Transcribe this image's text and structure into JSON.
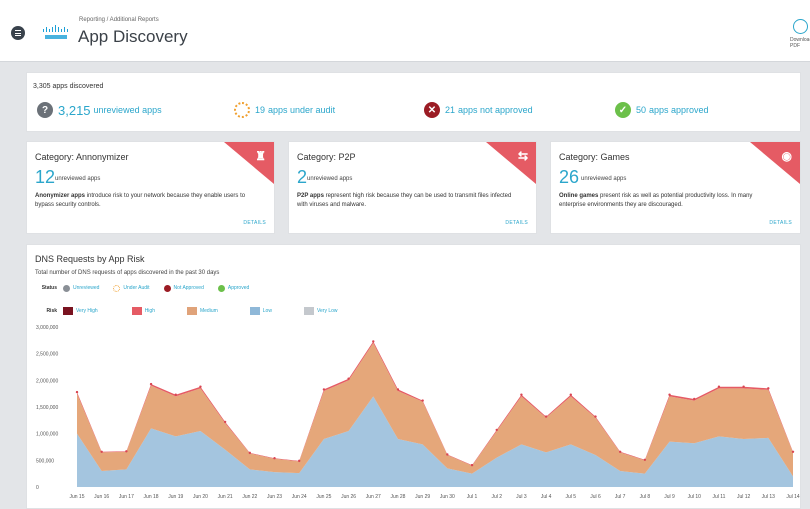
{
  "header": {
    "breadcrumb": "Reporting / Additional Reports",
    "title": "App Discovery",
    "download_label": "Download PDF"
  },
  "summary": {
    "discovered": "3,305 apps discovered",
    "stats": [
      {
        "count": "3,215",
        "label": "unreviewed apps",
        "icon": "question-icon",
        "color": "#6b7178"
      },
      {
        "count": "19",
        "label": "apps under audit",
        "icon": "under-audit-icon",
        "color": "#f0a030"
      },
      {
        "count": "21",
        "label": "apps not approved",
        "icon": "not-approved-icon",
        "color": "#9b1c24"
      },
      {
        "count": "50",
        "label": "apps approved",
        "icon": "approved-icon",
        "color": "#6cc04a"
      }
    ]
  },
  "cards": [
    {
      "title": "Category: Annonymizer",
      "count": "12",
      "count_label": "unreviewed apps",
      "desc_bold": "Anonymizer apps",
      "desc": " introduce risk to your network because they enable users to bypass security controls.",
      "details": "DETAILS",
      "icon": "anonymizer-icon"
    },
    {
      "title": "Category: P2P",
      "count": "2",
      "count_label": "unreviewed apps",
      "desc_bold": "P2P apps",
      "desc": " represent high risk because they can be used to transmit files infected with viruses and malware.",
      "details": "DETAILS",
      "icon": "transfer-icon"
    },
    {
      "title": "Category: Games",
      "count": "26",
      "count_label": "unreviewed apps",
      "desc_bold": "Online games",
      "desc": " present risk as well as potential productivity loss. In many enterprise environments they are discouraged.",
      "details": "DETAILS",
      "icon": "gamepad-icon"
    }
  ],
  "chart_panel": {
    "title": "DNS Requests by App Risk",
    "subtitle": "Total number of DNS requests of apps discovered in the past 30 days",
    "status_label": "Status",
    "status_items": [
      {
        "label": "Unreviewed",
        "color": "#8a8f96"
      },
      {
        "label": "Under Audit",
        "color": "#f0a030"
      },
      {
        "label": "Not Approved",
        "color": "#9b1c24"
      },
      {
        "label": "Approved",
        "color": "#6cc04a"
      }
    ],
    "risk_label": "Risk",
    "risk_items": [
      {
        "label": "Very High",
        "color": "#7a1320"
      },
      {
        "label": "High",
        "color": "#e55b64"
      },
      {
        "label": "Medium",
        "color": "#e0a37a"
      },
      {
        "label": "Low",
        "color": "#8fb8d8"
      },
      {
        "label": "Very Low",
        "color": "#c4c8cd"
      }
    ]
  },
  "chart_data": {
    "type": "area",
    "x": [
      "Jun 15",
      "Jun 16",
      "Jun 17",
      "Jun 18",
      "Jun 19",
      "Jun 20",
      "Jun 21",
      "Jun 22",
      "Jun 23",
      "Jun 24",
      "Jun 25",
      "Jun 26",
      "Jun 27",
      "Jun 28",
      "Jun 29",
      "Jun 30",
      "Jul 1",
      "Jul 2",
      "Jul 3",
      "Jul 4",
      "Jul 5",
      "Jul 6",
      "Jul 7",
      "Jul 8",
      "Jul 9",
      "Jul 10",
      "Jul 11",
      "Jul 12",
      "Jul 13",
      "Jul 14"
    ],
    "yticks": [
      "3,000,000",
      "2,500,000",
      "2,000,000",
      "1,500,000",
      "1,000,000",
      "500,000",
      "0"
    ],
    "ylim": [
      0,
      3000000
    ],
    "stacked": true,
    "series": [
      {
        "name": "Low",
        "color": "#9cc0dc",
        "values": [
          1000000,
          300000,
          330000,
          1100000,
          950000,
          1050000,
          700000,
          330000,
          280000,
          260000,
          900000,
          1050000,
          1700000,
          900000,
          800000,
          350000,
          250000,
          550000,
          800000,
          650000,
          800000,
          600000,
          300000,
          250000,
          850000,
          820000,
          950000,
          900000,
          920000,
          200000
        ]
      },
      {
        "name": "Medium",
        "color": "#e3a06f",
        "values": [
          750000,
          350000,
          330000,
          800000,
          750000,
          800000,
          500000,
          300000,
          250000,
          220000,
          900000,
          950000,
          1000000,
          900000,
          800000,
          250000,
          150000,
          500000,
          900000,
          650000,
          900000,
          700000,
          350000,
          250000,
          850000,
          800000,
          900000,
          950000,
          900000,
          450000
        ]
      },
      {
        "name": "High",
        "color": "#e55b64",
        "values": [
          30000,
          10000,
          10000,
          30000,
          30000,
          30000,
          20000,
          10000,
          10000,
          10000,
          30000,
          30000,
          30000,
          30000,
          20000,
          10000,
          10000,
          20000,
          30000,
          20000,
          30000,
          20000,
          10000,
          10000,
          30000,
          30000,
          30000,
          30000,
          30000,
          10000
        ]
      }
    ],
    "grid": false
  }
}
